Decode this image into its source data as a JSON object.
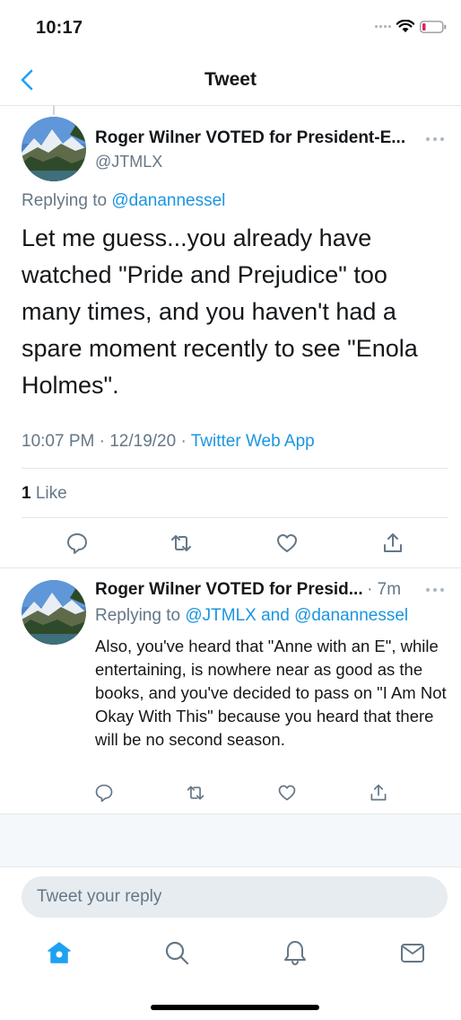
{
  "status_bar": {
    "time": "10:17",
    "icons": [
      "signal-icon",
      "wifi-icon",
      "battery-low-icon"
    ],
    "battery_color": "#e0245e"
  },
  "nav": {
    "title": "Tweet",
    "back_icon": "chevron-left-icon"
  },
  "main_tweet": {
    "author_name": "Roger Wilner VOTED for President-E...",
    "handle": "@JTMLX",
    "replying_prefix": "Replying to",
    "replying_to": "@danannessel",
    "text": "Let me guess...you already have watched \"Pride and Prejudice\" too many times, and you haven't had a spare moment recently to see \"Enola Holmes\".",
    "time": "10:07 PM",
    "date": "12/19/20",
    "separator": "·",
    "source": "Twitter Web App",
    "like_count": "1",
    "like_label": "Like",
    "actions": [
      "reply-icon",
      "retweet-icon",
      "like-icon",
      "share-icon"
    ]
  },
  "reply_tweet": {
    "author_name": "Roger Wilner VOTED for Presid...",
    "time_ago": "· 7m",
    "replying_prefix": "Replying to",
    "replying_to_1": "@JTMLX",
    "and_word": "and",
    "replying_to_2": "@danannessel",
    "text": "Also, you've heard that \"Anne with an E\", while entertaining, is nowhere near as good as the books, and you've decided to pass on \"I Am Not Okay With This\" because you heard that there will be no second season.",
    "actions": [
      "reply-icon",
      "retweet-icon",
      "like-icon",
      "share-icon"
    ]
  },
  "compose": {
    "placeholder": "Tweet your reply"
  },
  "tab_bar": {
    "items": [
      "home-icon",
      "search-icon",
      "notifications-icon",
      "messages-icon"
    ],
    "active_color": "#1da1f2"
  },
  "colors": {
    "link": "#1b95e0",
    "secondary_text": "#657786",
    "primary_text": "#14171a"
  }
}
